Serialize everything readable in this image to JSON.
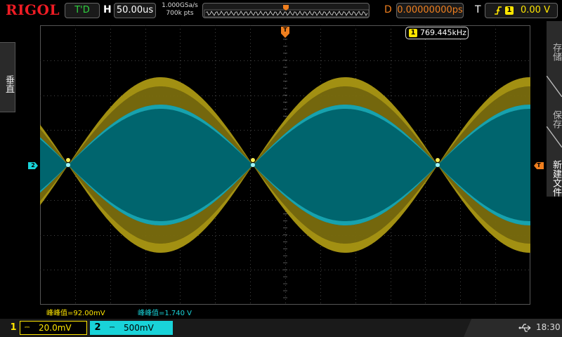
{
  "topbar": {
    "brand": "RIGOL",
    "run_state": "T'D",
    "horizontal_label": "H",
    "timebase": "50.00us",
    "sample_rate": "1.000GSa/s",
    "memory_depth": "700k pts",
    "delay_label": "D",
    "delay": "0.00000000ps",
    "trigger_label": "T",
    "trigger_source": "1",
    "trigger_level": "0.00 V"
  },
  "left_panel": {
    "vertical_tab": "垂直"
  },
  "right_panel": {
    "menu": [
      {
        "label": "存储"
      },
      {
        "label": "保存"
      },
      {
        "label": "新建文件"
      }
    ]
  },
  "screen": {
    "freq_source": "1",
    "frequency": "769.445kHz",
    "ch2_marker": "2",
    "trigger_level_marker": "T",
    "trigger_pos_marker": "T",
    "meas1": "峰峰值=92.00mV",
    "meas2": "峰峰值=1.740 V"
  },
  "channels": [
    {
      "num": "1",
      "coupling": "⎓",
      "scale": "20.0mV",
      "color": "#ffe600"
    },
    {
      "num": "2",
      "coupling": "⎓",
      "scale": "500mV",
      "color": "#19d3d9"
    }
  ],
  "status": {
    "usb_icon": "usb-icon",
    "time": "18:30"
  },
  "colors": {
    "ch1": "#ffe600",
    "ch2": "#19d3d9",
    "trigger": "#f07f1e",
    "brand": "#ee1c24"
  }
}
